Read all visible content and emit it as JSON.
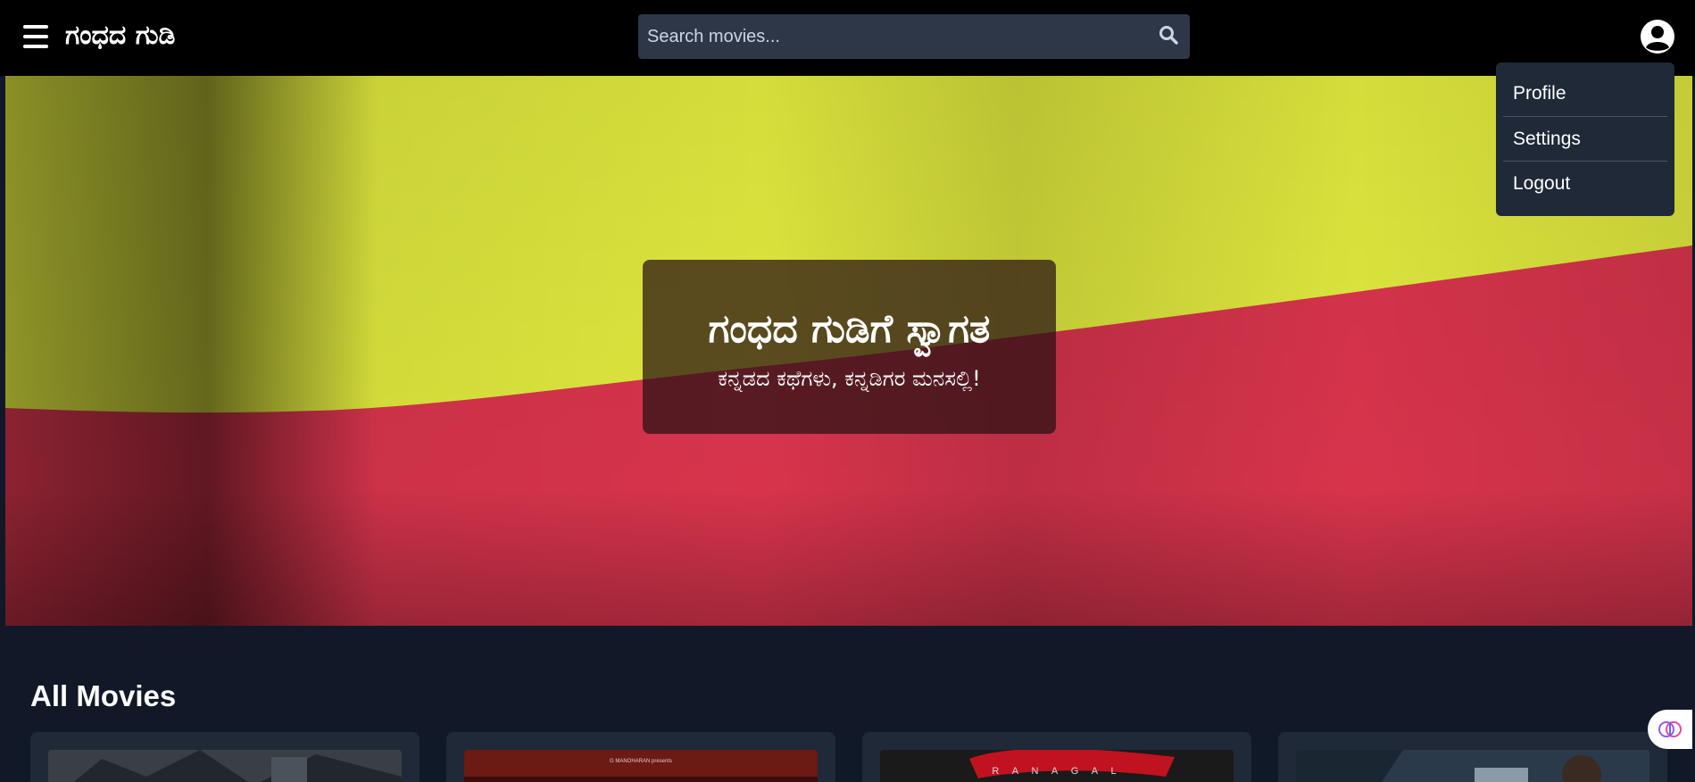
{
  "navbar": {
    "brand": "ಗಂಧದ ಗುಡಿ",
    "search_placeholder": "Search movies..."
  },
  "user_menu": {
    "items": [
      {
        "label": "Profile"
      },
      {
        "label": "Settings"
      },
      {
        "label": "Logout"
      }
    ]
  },
  "hero": {
    "title": "ಗಂಧದ ಗುಡಿಗೆ ಸ್ವಾಗತ",
    "subtitle": "ಕನ್ನಡದ ಕಥೆಗಳು, ಕನ್ನಡಿಗರ ಮನಸಲ್ಲಿ!",
    "flag_colors": {
      "top": "#dfe83e",
      "bottom": "#d7344c"
    }
  },
  "movies": {
    "section_title": "All Movies",
    "posters": [
      {
        "icon": "poster-action-icon",
        "tone": "#3a3f46"
      },
      {
        "icon": "poster-red-icon",
        "tone": "#6b1a14",
        "caption": "G MANOHARAN presents"
      },
      {
        "icon": "poster-ranagal-icon",
        "tone": "#1a1a1a",
        "caption": "R A N A G A L"
      },
      {
        "icon": "poster-hero-icon",
        "tone": "#2b3a4a"
      }
    ]
  },
  "colors": {
    "page_bg": "#111827",
    "navbar_bg": "#000000",
    "search_bg": "#2d3748",
    "dropdown_bg": "#1f2937",
    "card_bg": "#1f2937"
  }
}
